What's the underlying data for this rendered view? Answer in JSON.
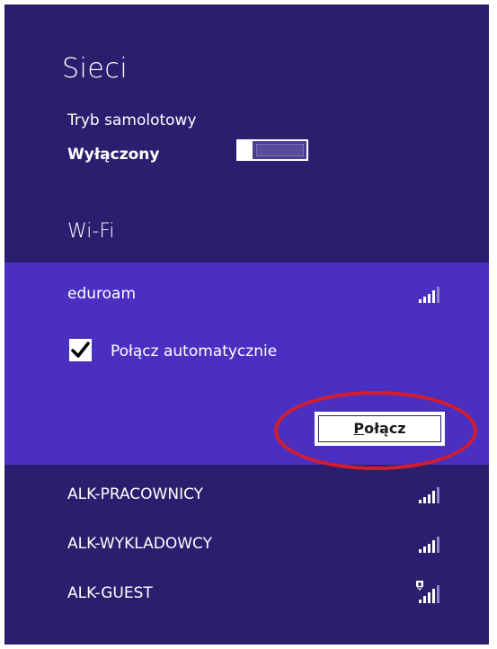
{
  "panel": {
    "title": "Sieci",
    "background": "#2a1f6e"
  },
  "airplane_mode": {
    "label": "Tryb samolotowy",
    "state": "Wyłączony",
    "toggle_on": false
  },
  "wifi": {
    "section_title": "Wi-Fi",
    "selected": {
      "name": "eduroam",
      "signal_icon": "signal-strength-icon",
      "auto_connect_label": "Połącz automatycznie",
      "auto_connect_checked": true,
      "connect_button": "Połącz",
      "connect_button_hotkey": "P",
      "connect_button_rest": "ołącz",
      "highlight_color": "#d41c2c",
      "selected_background": "#4a2fc1"
    },
    "networks": [
      {
        "name": "ALK-PRACOWNICY",
        "signal_icon": "signal-strength-icon",
        "secured_warning": false
      },
      {
        "name": "ALK-WYKLADOWCY",
        "signal_icon": "signal-strength-icon",
        "secured_warning": false
      },
      {
        "name": "ALK-GUEST",
        "signal_icon": "signal-warning-icon",
        "secured_warning": true
      }
    ]
  }
}
